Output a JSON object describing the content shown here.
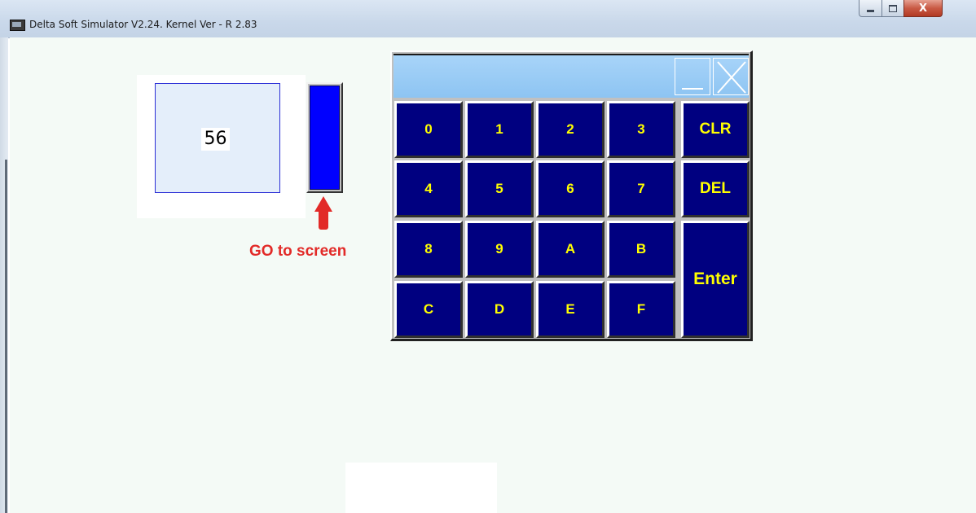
{
  "window": {
    "title": "Delta Soft Simulator V2.24. Kernel Ver - R 2.83",
    "minimize_icon": "minimize-icon",
    "maximize_icon": "maximize-icon",
    "close_icon": "close-icon",
    "close_glyph": "X"
  },
  "display": {
    "value": "56"
  },
  "go_button": {
    "color": "#0000ff",
    "annotation": "GO to screen",
    "annotation_color": "#e22a28",
    "arrow_icon": "arrow-up-icon"
  },
  "keypad": {
    "input_value": "",
    "key_color": "#000080",
    "key_text_color": "#ffff00",
    "keys": [
      "0",
      "1",
      "2",
      "3",
      "CLR",
      "4",
      "5",
      "6",
      "7",
      "DEL",
      "8",
      "9",
      "A",
      "B",
      "Enter",
      "C",
      "D",
      "E",
      "F"
    ]
  }
}
